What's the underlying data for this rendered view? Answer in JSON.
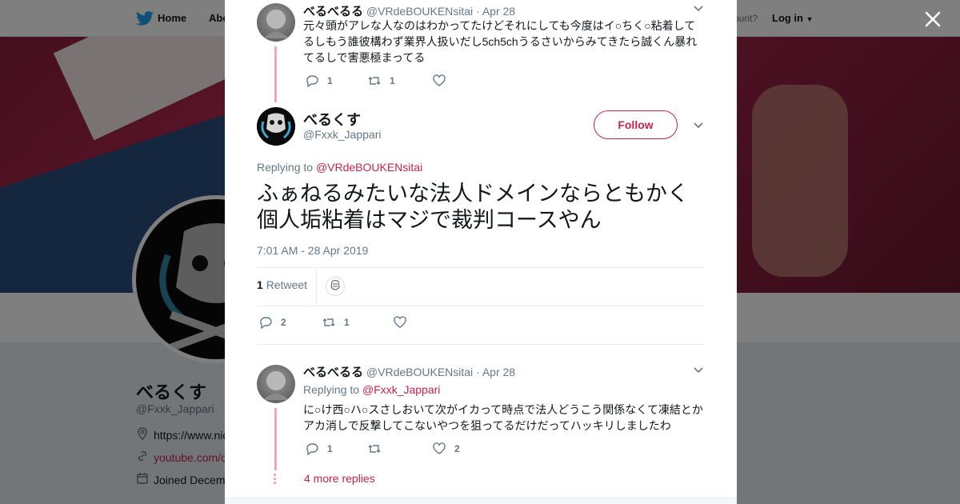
{
  "nav": {
    "home": "Home",
    "about": "Abo",
    "account": "ccount?",
    "login": "Log in"
  },
  "profile": {
    "name": "べるくす",
    "handle": "@Fxxk_Jappari",
    "website": "https://www.nic",
    "link": "youtube.com/c",
    "joined": "Joined Decem"
  },
  "thread": {
    "parent": {
      "name": "べるべるる",
      "handle": "@VRdeBOUKENsitai",
      "date": "Apr 28",
      "text": "元々頭がアレな人なのはわかってたけどそれにしても今度はイ○ちく○粘着してるしもう誰彼構わず業界人扱いだし5ch5chうるさいからみてきたら誠くん暴れてるしで害悪極まってる",
      "replies": "1",
      "retweets": "1",
      "likes": ""
    },
    "main": {
      "name": "べるくす",
      "handle": "@Fxxk_Jappari",
      "follow": "Follow",
      "replying_prefix": "Replying to",
      "replying_to": "@VRdeBOUKENsitai",
      "text": "ふぁねるみたいな法人ドメインならともかく個人垢粘着はマジで裁判コースやん",
      "timestamp": "7:01 AM - 28 Apr 2019",
      "retweet_count": "1",
      "retweet_label": "Retweet",
      "replies": "2",
      "retweets": "1",
      "likes": ""
    },
    "reply": {
      "name": "べるべるる",
      "handle": "@VRdeBOUKENsitai",
      "date": "Apr 28",
      "replying_prefix": "Replying to",
      "replying_to": "@Fxxk_Jappari",
      "text": "に○け西○ハ○スさしおいて次がイカって時点で法人どうこう関係なくて凍結とかアカ消しで反撃してこないやつを狙ってるだけだってハッキリしましたわ",
      "replies": "1",
      "retweets": "",
      "likes": "2"
    },
    "more_replies": "4 more replies"
  },
  "colors": {
    "accent": "#c3244f",
    "thread_line": "#f3a8b9",
    "muted": "#657786"
  }
}
